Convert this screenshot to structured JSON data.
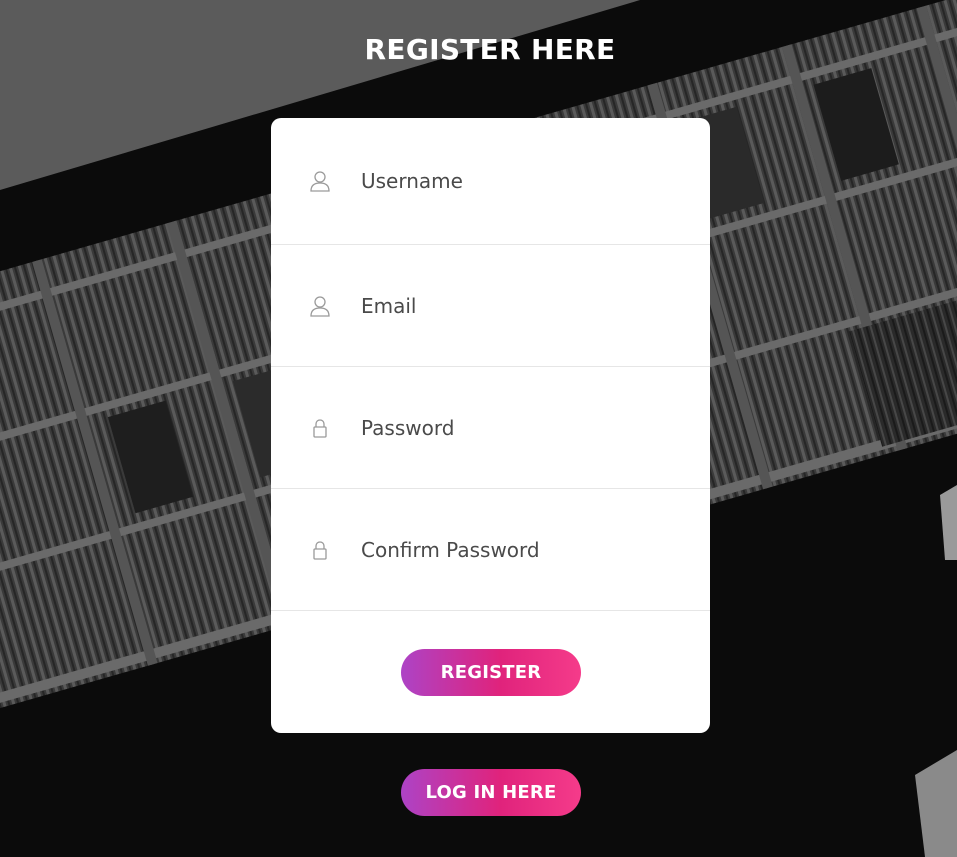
{
  "header": {
    "title": "REGISTER HERE"
  },
  "form": {
    "fields": [
      {
        "placeholder": "Username",
        "icon": "user-icon"
      },
      {
        "placeholder": "Email",
        "icon": "user-icon"
      },
      {
        "placeholder": "Password",
        "icon": "lock-icon"
      },
      {
        "placeholder": "Confirm Password",
        "icon": "lock-icon"
      }
    ],
    "register_label": "REGISTER"
  },
  "footer": {
    "login_label": "LOG IN HERE"
  },
  "colors": {
    "gradient_start": "#ad43c6",
    "gradient_mid": "#e0237c",
    "gradient_end": "#f53b8a",
    "card_bg": "#ffffff",
    "page_bg": "#0b0b0b"
  }
}
